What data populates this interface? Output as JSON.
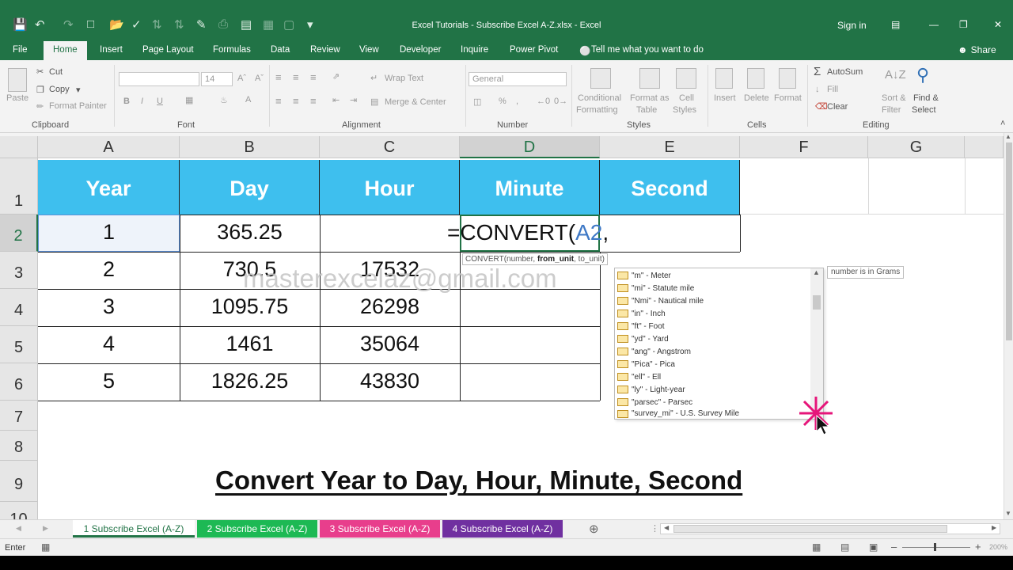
{
  "title_bar": {
    "title": "Excel Tutorials - Subscribe Excel A-Z.xlsx  -  Excel",
    "sign_in": "Sign in",
    "share": "Share"
  },
  "ribbon_tabs": [
    "File",
    "Home",
    "Insert",
    "Page Layout",
    "Formulas",
    "Data",
    "Review",
    "View",
    "Developer",
    "Inquire",
    "Power Pivot",
    "Tell me what you want to do"
  ],
  "ribbon": {
    "clipboard": {
      "paste": "Paste",
      "cut": "Cut",
      "copy": "Copy",
      "format_painter": "Format Painter",
      "label": "Clipboard"
    },
    "font": {
      "size": "14",
      "bold": "B",
      "italic": "I",
      "underline": "U",
      "label": "Font"
    },
    "alignment": {
      "wrap_text": "Wrap Text",
      "merge_center": "Merge & Center",
      "label": "Alignment"
    },
    "number": {
      "format": "General",
      "label": "Number"
    },
    "styles": {
      "conditional": "Conditional",
      "formatting": "Formatting",
      "format_as": "Format as",
      "table": "Table",
      "cell": "Cell",
      "styles_word": "Styles",
      "label": "Styles"
    },
    "cells": {
      "insert": "Insert",
      "delete": "Delete",
      "format": "Format",
      "label": "Cells"
    },
    "editing": {
      "autosum": "AutoSum",
      "fill": "Fill",
      "clear": "Clear",
      "sort_filter_1": "Sort &",
      "sort_filter_2": "Filter",
      "find_select_1": "Find &",
      "find_select_2": "Select",
      "label": "Editing"
    }
  },
  "columns": [
    "A",
    "B",
    "C",
    "D",
    "E",
    "F",
    "G"
  ],
  "rows": [
    "1",
    "2",
    "3",
    "4",
    "5",
    "6",
    "7",
    "8",
    "9",
    "10"
  ],
  "headers": [
    "Year",
    "Day",
    "Hour",
    "Minute",
    "Second"
  ],
  "table": [
    [
      "1",
      "365.25",
      "",
      ""
    ],
    [
      "2",
      "730.5",
      "17532",
      ""
    ],
    [
      "3",
      "1095.75",
      "26298",
      ""
    ],
    [
      "4",
      "1461",
      "35064",
      ""
    ],
    [
      "5",
      "1826.25",
      "43830",
      ""
    ]
  ],
  "formula": {
    "prefix": "=CONVERT(",
    "ref": "A2",
    ",": ","
  },
  "formula_tip": {
    "fn": "CONVERT(number, ",
    "bold": "from_unit",
    ",rest": ", to_unit)"
  },
  "watermark": "masterexcelaz@gmail.com",
  "unit_list": [
    "\"m\" - Meter",
    "\"mi\" - Statute mile",
    "\"Nmi\" - Nautical mile",
    "\"in\" - Inch",
    "\"ft\" - Foot",
    "\"yd\" - Yard",
    "\"ang\" - Angstrom",
    "\"Pica\" - Pica",
    "\"ell\" - Ell",
    "\"ly\" - Light-year",
    "\"parsec\" - Parsec",
    "\"survey_mi\" - U.S. Survey Mile"
  ],
  "unit_tip": "number is in Grams",
  "caption": "Convert Year to Day, Hour, Minute, Second",
  "sheet_tabs": [
    {
      "label": "1 Subscribe Excel (A-Z)",
      "color": "#217346"
    },
    {
      "label": "2 Subscribe Excel (A-Z)",
      "color": "#1db954"
    },
    {
      "label": "3 Subscribe Excel (A-Z)",
      "color": "#e83e8c"
    },
    {
      "label": "4 Subscribe Excel (A-Z)",
      "color": "#7030a0"
    }
  ],
  "status": {
    "mode": "Enter",
    "zoom": "200%"
  },
  "accent": {
    "excel_green": "#217346",
    "header_fill": "#3ebfee"
  }
}
